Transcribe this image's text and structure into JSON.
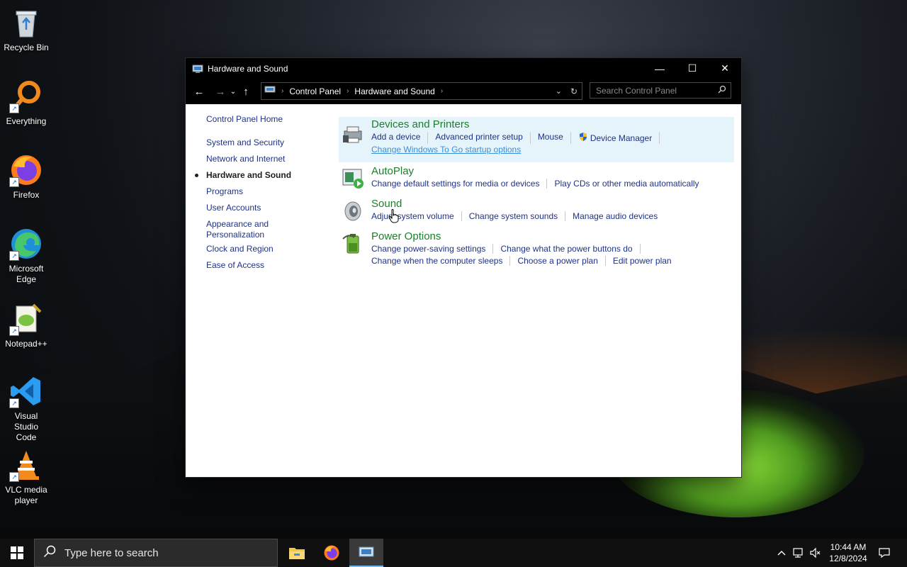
{
  "desktop": {
    "icons": [
      {
        "label": "Recycle Bin",
        "icon": "recycle-bin-icon"
      },
      {
        "label": "Everything",
        "icon": "everything-search-icon"
      },
      {
        "label": "Firefox",
        "icon": "firefox-icon"
      },
      {
        "label": "Microsoft Edge",
        "icon": "edge-icon"
      },
      {
        "label": "Notepad++",
        "icon": "notepadpp-icon"
      },
      {
        "label": "Visual Studio Code",
        "icon": "vscode-icon"
      },
      {
        "label": "VLC media player",
        "icon": "vlc-icon"
      }
    ]
  },
  "window": {
    "title": "Hardware and Sound",
    "controls": {
      "minimize": "—",
      "maximize": "☐",
      "close": "✕"
    }
  },
  "address": {
    "breadcrumb": [
      "Control Panel",
      "Hardware and Sound"
    ],
    "search_placeholder": "Search Control Panel"
  },
  "leftnav": {
    "home": "Control Panel Home",
    "items": [
      "System and Security",
      "Network and Internet",
      "Hardware and Sound",
      "Programs",
      "User Accounts",
      "Appearance and Personalization",
      "Clock and Region",
      "Ease of Access"
    ],
    "active": "Hardware and Sound"
  },
  "categories": [
    {
      "title": "Devices and Printers",
      "icon": "printer-icon",
      "links_row1": [
        "Add a device",
        "Advanced printer setup",
        "Mouse",
        "Device Manager"
      ],
      "links_row2": [
        "Change Windows To Go startup options"
      ]
    },
    {
      "title": "AutoPlay",
      "icon": "autoplay-icon",
      "links_row1": [
        "Change default settings for media or devices",
        "Play CDs or other media automatically"
      ]
    },
    {
      "title": "Sound",
      "icon": "speaker-icon",
      "links_row1": [
        "Adjust system volume",
        "Change system sounds",
        "Manage audio devices"
      ]
    },
    {
      "title": "Power Options",
      "icon": "battery-icon",
      "links_row1": [
        "Change power-saving settings",
        "Change what the power buttons do"
      ],
      "links_row2": [
        "Change when the computer sleeps",
        "Choose a power plan",
        "Edit power plan"
      ]
    }
  ],
  "taskbar": {
    "search_placeholder": "Type here to search",
    "time": "10:44 AM",
    "date": "12/8/2024"
  },
  "colors": {
    "link": "#1e3287",
    "category_title": "#1a7f2b",
    "highlight": "#e5f3fb"
  }
}
